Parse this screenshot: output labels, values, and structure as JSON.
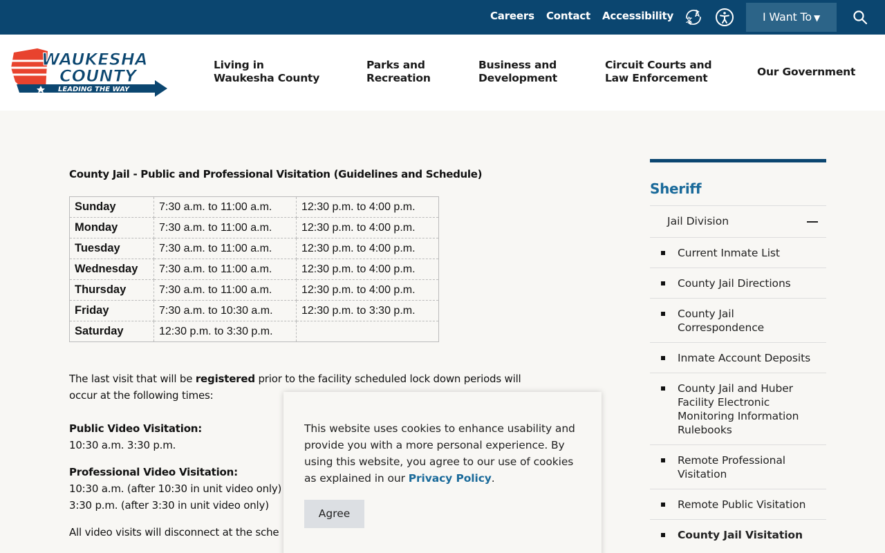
{
  "topbar": {
    "links": [
      "Careers",
      "Contact",
      "Accessibility"
    ],
    "translate_icon": "translate-icon",
    "accessibility_icon": "accessibility-icon",
    "i_want_to": "I Want To",
    "search_icon": "search-icon"
  },
  "logo": {
    "line1": "WAUKESHA",
    "line2": "COUNTY",
    "tagline": "LEADING THE WAY"
  },
  "nav": {
    "items": [
      {
        "line1": "Living in",
        "line2": "Waukesha County"
      },
      {
        "line1": "Parks and",
        "line2": "Recreation"
      },
      {
        "line1": "Business and",
        "line2": "Development"
      },
      {
        "line1": "Circuit Courts and",
        "line2": "Law Enforcement"
      },
      {
        "line1": "Our Government",
        "line2": ""
      }
    ]
  },
  "content": {
    "title": "County Jail - Public and Professional Visitation (Guidelines and Schedule)",
    "schedule": [
      {
        "day": "Sunday",
        "morning": "7:30 a.m. to 11:00 a.m.",
        "afternoon": "12:30 p.m. to 4:00 p.m."
      },
      {
        "day": "Monday",
        "morning": "7:30 a.m. to 11:00 a.m.",
        "afternoon": "12:30 p.m. to 4:00 p.m."
      },
      {
        "day": "Tuesday",
        "morning": "7:30 a.m. to 11:00 a.m.",
        "afternoon": "12:30 p.m. to 4:00 p.m."
      },
      {
        "day": "Wednesday",
        "morning": "7:30 a.m. to 11:00 a.m.",
        "afternoon": "12:30 p.m. to 4:00 p.m."
      },
      {
        "day": "Thursday",
        "morning": "7:30 a.m. to 11:00 a.m.",
        "afternoon": "12:30 p.m. to 4:00 p.m."
      },
      {
        "day": "Friday",
        "morning": "7:30 a.m. to 10:30 a.m.",
        "afternoon": "12:30 p.m. to 3:30 p.m."
      },
      {
        "day": "Saturday",
        "morning": "12:30 p.m. to 3:30 p.m.",
        "afternoon": ""
      }
    ],
    "last_visit_pre": "The last visit that will be ",
    "last_visit_bold": "registered",
    "last_visit_post": " prior to the facility scheduled lock down periods will",
    "last_visit_line2": "occur at the following times:",
    "public_video_heading": "Public Video Visitation:",
    "public_video_times": "10:30 a.m. 3:30 p.m.",
    "professional_video_heading": "Professional Video Visitation:",
    "professional_video_line1": "10:30 a.m. (after 10:30 in unit video only)",
    "professional_video_line2": "3:30 p.m. (after 3:30 in unit video only)",
    "disconnect_text": "All video visits will disconnect at the sche"
  },
  "sidebar": {
    "title": "Sheriff",
    "division": "Jail Division",
    "items": [
      "Current Inmate List",
      "County Jail Directions",
      "County Jail Correspondence",
      "Inmate Account Deposits",
      "County Jail and Huber Facility Electronic Monitoring Information Rulebooks",
      "Remote Professional Visitation",
      "Remote Public Visitation",
      "County Jail Visitation"
    ]
  },
  "cookie": {
    "text": "This website uses cookies to enhance usability and provide you with a more personal experience. By using this website, you agree to our use of cookies as explained in our ",
    "link": "Privacy Policy",
    "period": ".",
    "agree": "Agree"
  },
  "colors": {
    "topbar": "#0b4670",
    "accent": "#1a6a9a",
    "logo_red": "#e8432e",
    "logo_navy": "#0b4670"
  }
}
